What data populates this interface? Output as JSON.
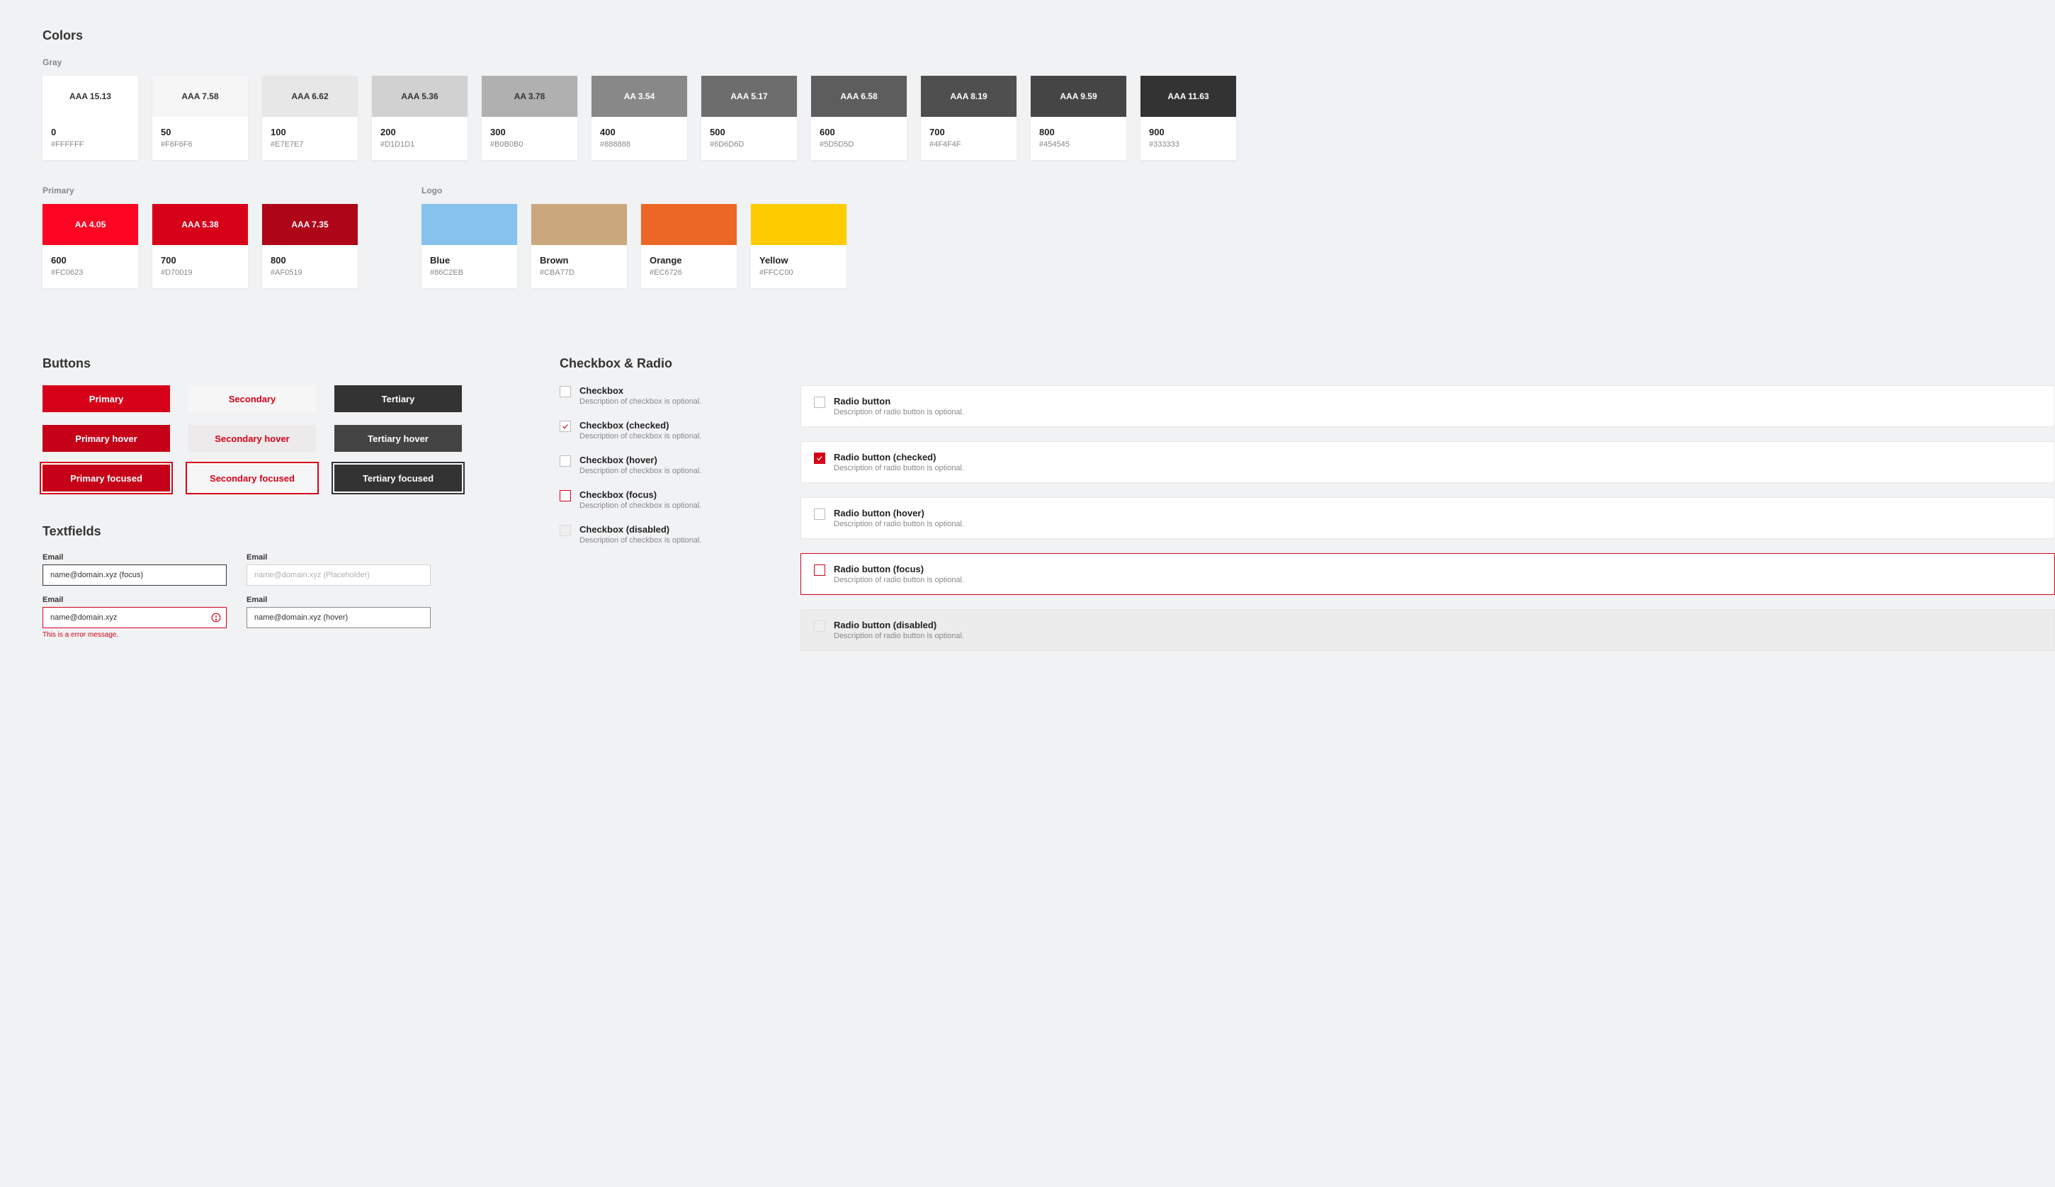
{
  "sections": {
    "colors": "Colors",
    "buttons": "Buttons",
    "checkbox_radio": "Checkbox & Radio",
    "textfields": "Textfields"
  },
  "gray": {
    "label": "Gray",
    "items": [
      {
        "contrast": "AAA 15.13",
        "name": "0",
        "hex": "#FFFFFF",
        "bg": "#FFFFFF",
        "fg": "#333"
      },
      {
        "contrast": "AAA 7.58",
        "name": "50",
        "hex": "#F6F6F6",
        "bg": "#F6F6F6",
        "fg": "#333"
      },
      {
        "contrast": "AAA 6.62",
        "name": "100",
        "hex": "#E7E7E7",
        "bg": "#E7E7E7",
        "fg": "#333"
      },
      {
        "contrast": "AAA 5.36",
        "name": "200",
        "hex": "#D1D1D1",
        "bg": "#D1D1D1",
        "fg": "#333"
      },
      {
        "contrast": "AA 3.78",
        "name": "300",
        "hex": "#B0B0B0",
        "bg": "#B0B0B0",
        "fg": "#333"
      },
      {
        "contrast": "AA 3.54",
        "name": "400",
        "hex": "#888888",
        "bg": "#888888",
        "fg": "#fff"
      },
      {
        "contrast": "AAA 5.17",
        "name": "500",
        "hex": "#6D6D6D",
        "bg": "#6D6D6D",
        "fg": "#fff"
      },
      {
        "contrast": "AAA 6.58",
        "name": "600",
        "hex": "#5D5D5D",
        "bg": "#5D5D5D",
        "fg": "#fff"
      },
      {
        "contrast": "AAA 8.19",
        "name": "700",
        "hex": "#4F4F4F",
        "bg": "#4F4F4F",
        "fg": "#fff"
      },
      {
        "contrast": "AAA 9.59",
        "name": "800",
        "hex": "#454545",
        "bg": "#454545",
        "fg": "#fff"
      },
      {
        "contrast": "AAA 11.63",
        "name": "900",
        "hex": "#333333",
        "bg": "#333333",
        "fg": "#fff"
      }
    ]
  },
  "primary": {
    "label": "Primary",
    "items": [
      {
        "contrast": "AA 4.05",
        "name": "600",
        "hex": "#FC0623",
        "bg": "#FC0623",
        "fg": "#fff"
      },
      {
        "contrast": "AAA 5.38",
        "name": "700",
        "hex": "#D70019",
        "bg": "#D70019",
        "fg": "#fff"
      },
      {
        "contrast": "AAA 7.35",
        "name": "800",
        "hex": "#AF0519",
        "bg": "#AF0519",
        "fg": "#fff"
      }
    ]
  },
  "logo": {
    "label": "Logo",
    "items": [
      {
        "contrast": "",
        "name": "Blue",
        "hex": "#86C2EB",
        "bg": "#86C2EB",
        "fg": "#fff"
      },
      {
        "contrast": "",
        "name": "Brown",
        "hex": "#CBA77D",
        "bg": "#CBA77D",
        "fg": "#fff"
      },
      {
        "contrast": "",
        "name": "Orange",
        "hex": "#EC6726",
        "bg": "#EC6726",
        "fg": "#fff"
      },
      {
        "contrast": "",
        "name": "Yellow",
        "hex": "#FFCC00",
        "bg": "#FFCC00",
        "fg": "#fff"
      }
    ]
  },
  "buttons": [
    {
      "label": "Primary",
      "variant": "primary"
    },
    {
      "label": "Secondary",
      "variant": "secondary"
    },
    {
      "label": "Tertiary",
      "variant": "tertiary"
    },
    {
      "label": "Primary hover",
      "variant": "primary hover"
    },
    {
      "label": "Secondary hover",
      "variant": "secondary hover"
    },
    {
      "label": "Tertiary hover",
      "variant": "tertiary hover"
    },
    {
      "label": "Primary focused",
      "variant": "primary focused"
    },
    {
      "label": "Secondary focused",
      "variant": "secondary focused"
    },
    {
      "label": "Tertiary focused",
      "variant": "tertiary focused"
    }
  ],
  "textfields": {
    "label_email": "Email",
    "focus_value": "name@domain.xyz (focus)",
    "placeholder": "name@domain.xyz (Placeholder)",
    "error_value": "name@domain.xyz",
    "hover_value": "name@domain.xyz (hover)",
    "error_message": "This is a error message."
  },
  "checkboxes": [
    {
      "title": "Checkbox",
      "desc": "Description of checkbox is optional.",
      "state": "default"
    },
    {
      "title": "Checkbox (checked)",
      "desc": "Description of checkbox is optional.",
      "state": "checked"
    },
    {
      "title": "Checkbox (hover)",
      "desc": "Description of checkbox is optional.",
      "state": "hover"
    },
    {
      "title": "Checkbox (focus)",
      "desc": "Description of checkbox is optional.",
      "state": "focus"
    },
    {
      "title": "Checkbox (disabled)",
      "desc": "Description of checkbox is optional.",
      "state": "disabled"
    }
  ],
  "radios": [
    {
      "title": "Radio button",
      "desc": "Description of radio button is optional.",
      "state": "default"
    },
    {
      "title": "Radio button (checked)",
      "desc": "Description of radio button is optional.",
      "state": "checked"
    },
    {
      "title": "Radio button (hover)",
      "desc": "Description of radio button is optional.",
      "state": "hover"
    },
    {
      "title": "Radio button (focus)",
      "desc": "Description of radio button is optional.",
      "state": "focus"
    },
    {
      "title": "Radio button (disabled)",
      "desc": "Description of radio button is optional.",
      "state": "disabled"
    }
  ]
}
